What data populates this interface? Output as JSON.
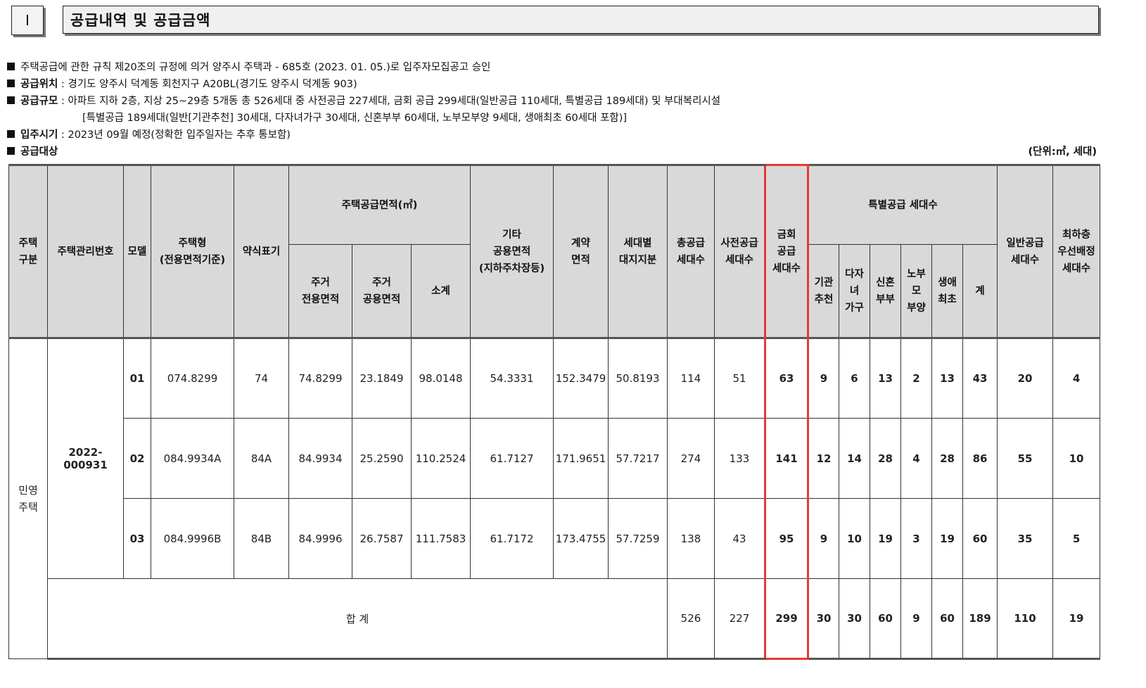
{
  "section": {
    "number": "Ⅰ",
    "title": "공급내역 및 공급금액"
  },
  "info": {
    "approval": "주택공급에 관한 규칙 제20조의 규정에 의거 양주시 주택과 - 685호 (2023. 01. 05.)로 입주자모집공고 승인",
    "location_label": "공급위치",
    "location": " : 경기도 양주시 덕계동 회천지구 A20BL(경기도 양주시 덕계동 903)",
    "scale_label": "공급규모",
    "scale": " : 아파트 지하 2층, 지상 25~29층 5개동 총 526세대 중 사전공급 227세대, 금회 공급 299세대(일반공급 110세대, 특별공급 189세대) 및 부대복리시설",
    "scale_detail": "[특별공급 189세대(일반[기관추천] 30세대, 다자녀가구 30세대, 신혼부부 60세대, 노부모부양 9세대, 생애최초 60세대 포함)]",
    "move_label": "입주시기",
    "move": " : 2023년 09월 예정(정확한 입주일자는 추후 통보함)",
    "target_label": "공급대상",
    "unit": "(단위:㎡, 세대)"
  },
  "headers": {
    "type": "주택\n구분",
    "mgmt_no": "주택관리번호",
    "model": "모델",
    "housing_type": "주택형\n(전용면적기준)",
    "short": "약식표기",
    "area_group": "주택공급면적(㎡)",
    "exclusive": "주거\n전용면적",
    "common": "주거\n공용면적",
    "subtotal": "소계",
    "other_common": "기타\n공용면적\n(지하주차장등)",
    "contract": "계약\n면적",
    "land": "세대별\n대지지분",
    "total_supply": "총공급\n세대수",
    "pre_supply": "사전공급\n세대수",
    "this_supply": "금회\n공급\n세대수",
    "special_group": "특별공급 세대수",
    "institution": "기관\n추천",
    "multi_child": "다자\n녀\n가구",
    "newlywed": "신혼\n부부",
    "elderly": "노부\n모\n부양",
    "first_life": "생애\n최초",
    "special_total": "계",
    "general": "일반공급\n세대수",
    "lowest_floor": "최하층\n우선배정\n세대수"
  },
  "type_label": "민영\n주택",
  "mgmt_no_value": "2022-000931",
  "rows": [
    {
      "model": "01",
      "housing_type": "074.8299",
      "short": "74",
      "exclusive": "74.8299",
      "common": "23.1849",
      "subtotal": "98.0148",
      "other_common": "54.3331",
      "contract": "152.3479",
      "land": "50.8193",
      "total_supply": "114",
      "pre_supply": "51",
      "this_supply": "63",
      "institution": "9",
      "multi_child": "6",
      "newlywed": "13",
      "elderly": "2",
      "first_life": "13",
      "special_total": "43",
      "general": "20",
      "lowest_floor": "4"
    },
    {
      "model": "02",
      "housing_type": "084.9934A",
      "short": "84A",
      "exclusive": "84.9934",
      "common": "25.2590",
      "subtotal": "110.2524",
      "other_common": "61.7127",
      "contract": "171.9651",
      "land": "57.7217",
      "total_supply": "274",
      "pre_supply": "133",
      "this_supply": "141",
      "institution": "12",
      "multi_child": "14",
      "newlywed": "28",
      "elderly": "4",
      "first_life": "28",
      "special_total": "86",
      "general": "55",
      "lowest_floor": "10"
    },
    {
      "model": "03",
      "housing_type": "084.9996B",
      "short": "84B",
      "exclusive": "84.9996",
      "common": "26.7587",
      "subtotal": "111.7583",
      "other_common": "61.7172",
      "contract": "173.4755",
      "land": "57.7259",
      "total_supply": "138",
      "pre_supply": "43",
      "this_supply": "95",
      "institution": "9",
      "multi_child": "10",
      "newlywed": "19",
      "elderly": "3",
      "first_life": "19",
      "special_total": "60",
      "general": "35",
      "lowest_floor": "5"
    }
  ],
  "totals": {
    "label": "합 계",
    "total_supply": "526",
    "pre_supply": "227",
    "this_supply": "299",
    "institution": "30",
    "multi_child": "30",
    "newlywed": "60",
    "elderly": "9",
    "first_life": "60",
    "special_total": "189",
    "general": "110",
    "lowest_floor": "19"
  },
  "highlight_color": "#e53935"
}
